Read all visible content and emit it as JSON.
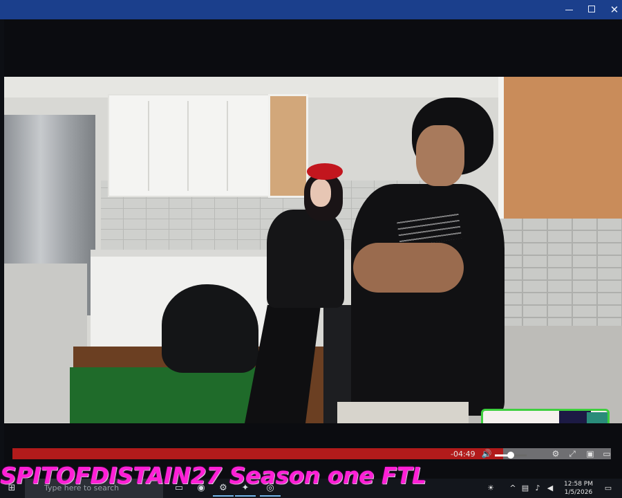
{
  "window": {
    "minimize_icon": "minimize-icon",
    "maximize_icon": "maximize-icon",
    "close_icon": "close-icon",
    "close_glyph": "✕"
  },
  "video": {
    "scene": "kitchen",
    "progress": 0.82,
    "time_remaining": "-04:49",
    "volume": 0.5,
    "accent_color": "#b21b1b",
    "webcam_border_color": "#3ecf3e"
  },
  "controls": {
    "volume_icon": "volume-icon",
    "volume_glyph": "🔊",
    "settings_icon": "settings-icon",
    "settings_glyph": "⚙",
    "fullscreen_icon": "fullscreen-icon",
    "fullscreen_glyph": "⤢",
    "pip_icon": "picture-in-picture-icon",
    "pip_glyph": "▣"
  },
  "caption": {
    "text": "SPITOFDISTAIN27 Season one FTL",
    "color": "#ff1fd6"
  },
  "taskbar": {
    "search_placeholder": "Type here to search",
    "apps": [
      {
        "icon": "discord-icon",
        "glyph": "◉"
      },
      {
        "icon": "gear-icon",
        "glyph": "⚙"
      },
      {
        "icon": "game-icon",
        "glyph": "✦"
      },
      {
        "icon": "browser-icon",
        "glyph": "◎"
      }
    ],
    "tray": {
      "weather_glyph": "☀",
      "chevron_glyph": "^",
      "network_glyph": "▤",
      "mic_glyph": "♪",
      "speaker_glyph": "◀",
      "notification_glyph": "▭"
    },
    "clock_time": "12:58 PM",
    "clock_date": "1/5/2026"
  }
}
